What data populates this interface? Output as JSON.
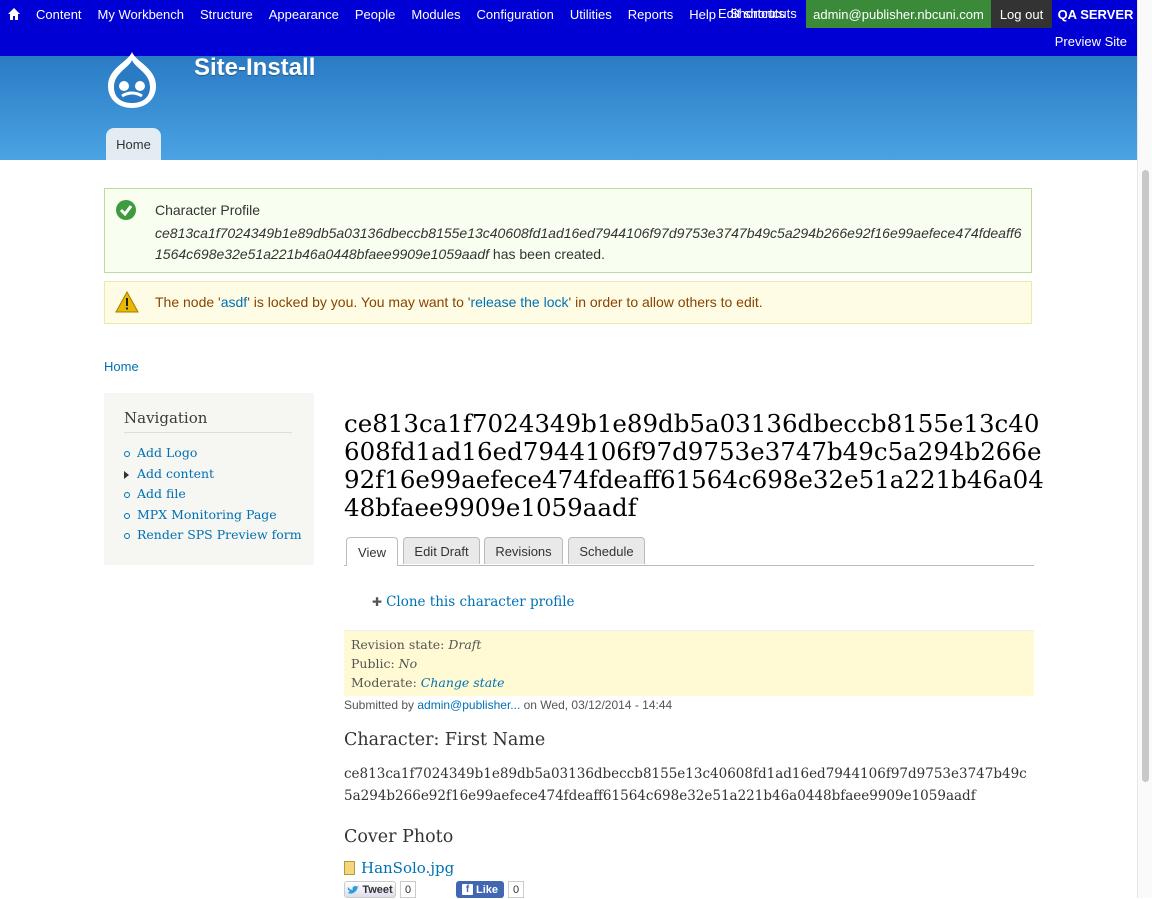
{
  "toolbar": {
    "menu": [
      "Content",
      "My Workbench",
      "Structure",
      "Appearance",
      "People",
      "Modules",
      "Configuration",
      "Utilities",
      "Reports",
      "Help"
    ],
    "overlap_a": "Edit shortcuts",
    "overlap_b": "Shortcuts",
    "user": "admin@publisher.nbcuni.com",
    "logout": "Log out",
    "server": "QA SERVER",
    "preview": "Preview Site"
  },
  "header": {
    "site_name": "Site-Install",
    "tab_home": "Home"
  },
  "status_message": {
    "line1": "Character Profile",
    "name": "ce813ca1f7024349b1e89db5a03136dbeccb8155e13c40608fd1ad16ed7944106f97d9753e3747b49c5a294b266e92f16e99aefece474fdeaff61564c698e32e51a221b46a0448bfaee9909e1059aadf",
    "suffix": " has been created."
  },
  "warning_message": {
    "prefix": "The node '",
    "node_link": "asdf",
    "middle": "' is locked by you. You may want to '",
    "release_link": "release the lock",
    "suffix": "' in order to allow others to edit."
  },
  "breadcrumb": "Home",
  "sidebar": {
    "title": "Navigation",
    "items": [
      "Add Logo",
      "Add content",
      "Add file",
      "MPX Monitoring Page",
      "Render SPS Preview form"
    ]
  },
  "page_title": "ce813ca1f7024349b1e89db5a03136dbeccb8155e13c40608fd1ad16ed7944106f97d9753e3747b49c5a294b266e92f16e99aefece474fdeaff61564c698e32e51a221b46a0448bfaee9909e1059aadf",
  "tabs": [
    "View",
    "Edit Draft",
    "Revisions",
    "Schedule"
  ],
  "clone_link": "Clone this character profile",
  "workbench": {
    "revision_label": "Revision state: ",
    "revision_value": "Draft",
    "public_label": "Public: ",
    "public_value": "No",
    "moderate_label": "Moderate: ",
    "moderate_value": "Change state"
  },
  "submitted": {
    "prefix": "Submitted by ",
    "author": "admin@publisher...",
    "suffix": " on Wed, 03/12/2014 - 14:44"
  },
  "first_name": {
    "label": "Character: First Name",
    "value": "ce813ca1f7024349b1e89db5a03136dbeccb8155e13c40608fd1ad16ed7944106f97d9753e3747b49c5a294b266e92f16e99aefece474fdeaff61564c698e32e51a221b46a0448bfaee9909e1059aadf"
  },
  "cover_photo": {
    "label": "Cover Photo",
    "file": "HanSolo.jpg"
  },
  "social": {
    "tweet": "Tweet",
    "tweet_count": "0",
    "like": "Like",
    "like_count": "0"
  }
}
